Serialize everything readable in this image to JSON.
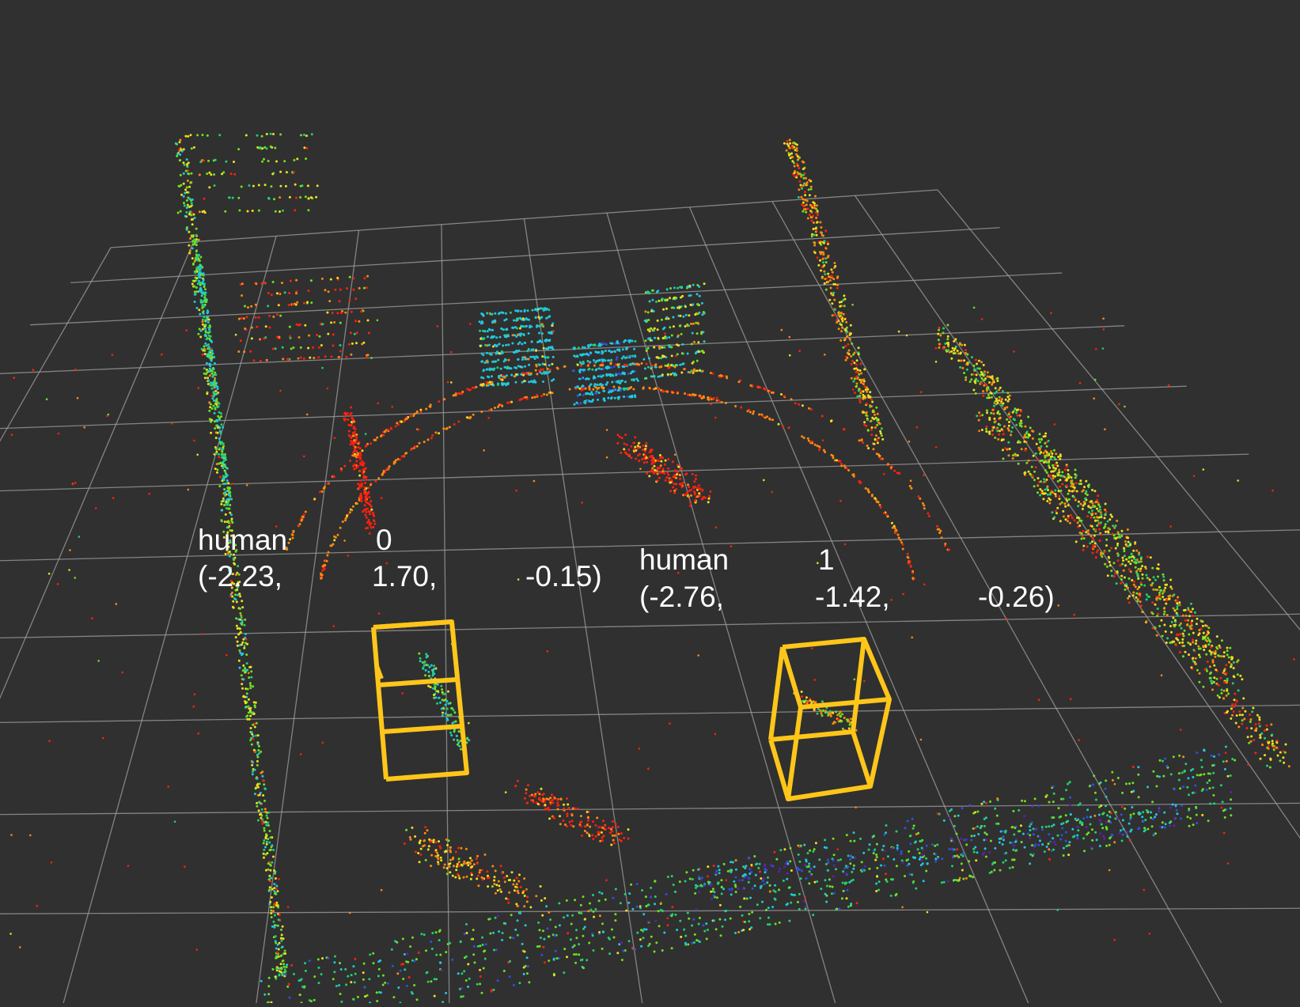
{
  "scene": {
    "background": "#303030",
    "grid_color": "#a0a0a0",
    "box_color": "#ffc61a",
    "pointcloud_colormap": [
      "#ff2010",
      "#ff8a10",
      "#f0e020",
      "#70e020",
      "#20d070",
      "#20c8e0",
      "#3050e0",
      "#6020b0"
    ]
  },
  "detections": [
    {
      "label": "human",
      "id": "0",
      "x": "(-2.23,",
      "y": "1.70,",
      "z": "-0.15)"
    },
    {
      "label": "human",
      "id": "1",
      "x": "(-2.76,",
      "y": "-1.42,",
      "z": "-0.26)"
    }
  ]
}
